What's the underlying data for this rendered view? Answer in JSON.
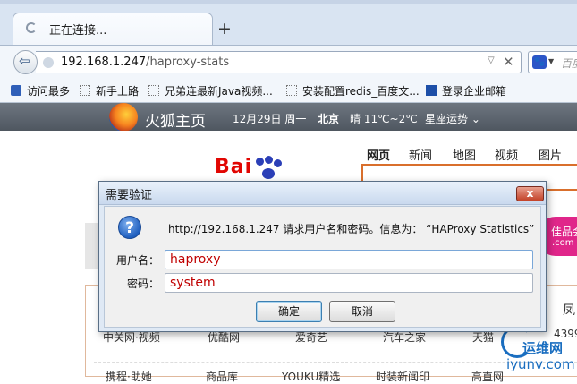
{
  "browser": {
    "tab_title": "正在连接...",
    "new_tab_symbol": "+",
    "url_host": "192.168.1.247",
    "url_path": "/haproxy-stats",
    "search_placeholder": "百度",
    "bookmarks": [
      {
        "label": "访问最多",
        "icon": "book-icon"
      },
      {
        "label": "新手上路",
        "icon": "page-icon"
      },
      {
        "label": "兄弟连最新Java视频...",
        "icon": "page-icon"
      },
      {
        "label": "安装配置redis_百度文...",
        "icon": "page-icon"
      },
      {
        "label": "登录企业邮箱",
        "icon": "mail-logo-icon"
      }
    ]
  },
  "ffhome": {
    "title": "火狐主页",
    "date": "12月29日 周一",
    "city": "北京",
    "weather": "晴 11℃~2℃",
    "horoscope": "星座运势"
  },
  "baidu": {
    "nav": [
      "网页",
      "新闻",
      "地图",
      "视频",
      "图片"
    ],
    "logo_text": "Bai",
    "promo_text": "佳品会",
    "promo_sub": ".com",
    "row1": [
      "中关网·视频",
      "优酷网",
      "爱奇艺",
      "汽车之家",
      "天猫"
    ],
    "row2": [
      "携程·助她",
      "商品库",
      "YOUKU精选",
      "时装新闻印",
      "高直网"
    ],
    "side_feng": "凤",
    "side_4399": "4399"
  },
  "watermark": {
    "cn": "运维网",
    "en": "iyunv.com"
  },
  "dialog": {
    "title": "需要验证",
    "message": "http://192.168.1.247 请求用户名和密码。信息为： “HAProxy Statistics”",
    "username_label": "用户名：",
    "password_label": "密码：",
    "username_value": "haproxy",
    "password_value": "system",
    "ok_label": "确定",
    "cancel_label": "取消",
    "close_symbol": "x"
  }
}
